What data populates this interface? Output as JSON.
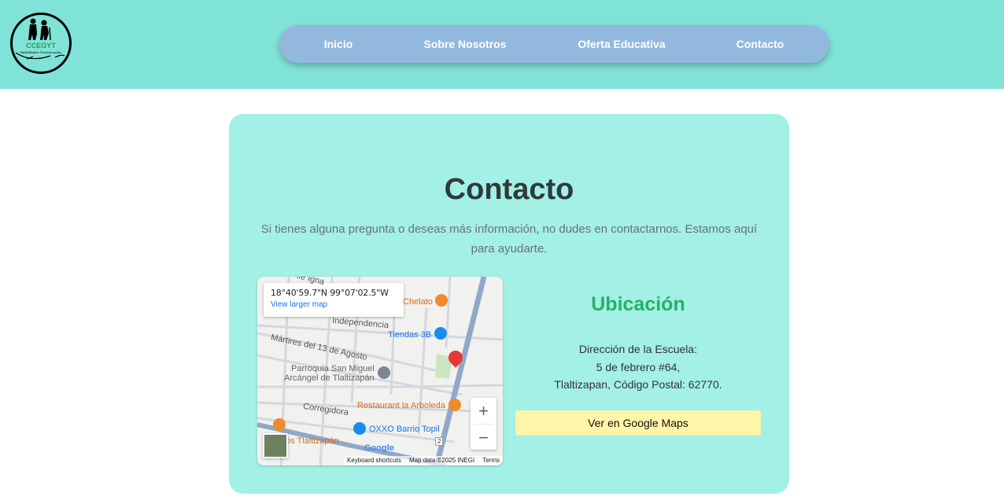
{
  "brand": {
    "logo_text": "CCEGYT",
    "logo_subtext": "Habilidades Profesionales"
  },
  "nav": {
    "items": [
      {
        "label": "Inicio"
      },
      {
        "label": "Sobre Nosotros"
      },
      {
        "label": "Oferta Educativa"
      },
      {
        "label": "Contacto"
      }
    ]
  },
  "contact": {
    "title": "Contacto",
    "intro": "Si tienes alguna pregunta o deseas más información, no dudes en contactarnos. Estamos aquí para ayudarte."
  },
  "map": {
    "coordinates": "18°40'59.7\"N 99°07'02.5\"W",
    "view_larger": "View larger map",
    "labels": {
      "chelato": "Chelato",
      "independencia": "Independencia",
      "tiendas": "Tiendas 3B",
      "martires": "Mártires del 13 de Agosto",
      "parroquia1": "Parroquia San Miguel",
      "parroquia2": "Arcángel de Tlaltizapán",
      "corregidora": "Corregidora",
      "arboleda": "Restaurant la Arboleda",
      "oxxo": "OXXO Barrio Topil",
      "tlaltizapan": "os Tlaltizapán",
      "road_number": "2",
      "street_top": "lle Igna"
    },
    "google": "Google",
    "footer": {
      "shortcuts": "Keyboard shortcuts",
      "mapdata": "Map data ©2025 INEGI",
      "terms": "Terms"
    },
    "zoom_in": "+",
    "zoom_out": "−"
  },
  "location": {
    "heading": "Ubicación",
    "address_line1": "Dirección de la Escuela:",
    "address_line2": "5 de febrero #64,",
    "address_line3": "Tlaltizapan, Código Postal: 62770.",
    "button_label": "Ver en Google Maps"
  },
  "colors": {
    "header_bg": "#80e3d7",
    "nav_bg": "#93b8de",
    "card_bg": "#a2f0e6",
    "accent_green": "#27b064",
    "button_bg": "#fef5a8"
  }
}
